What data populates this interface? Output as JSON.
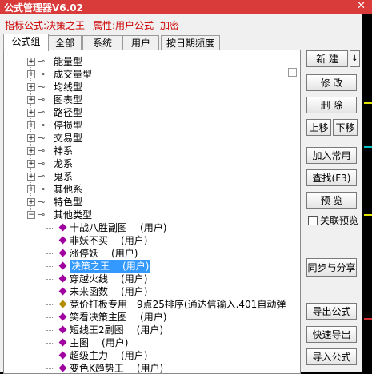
{
  "window": {
    "title": "公式管理器V6.02",
    "close_icon": "✕"
  },
  "info": {
    "formula_label": "指标公式:决策之王",
    "attr_label": "属性:用户公式",
    "enc_label": "加密"
  },
  "tabs": [
    "公式组",
    "全部",
    "系统",
    "用户",
    "按日期频度"
  ],
  "tree": {
    "groups": [
      "能量型",
      "成交量型",
      "均线型",
      "图表型",
      "路径型",
      "停损型",
      "交易型",
      "神系",
      "龙系",
      "鬼系",
      "其他系",
      "特色型",
      "其他类型"
    ],
    "items": [
      {
        "name": "十战八胜副图",
        "tag": "(用户)"
      },
      {
        "name": "非妖不买",
        "tag": "(用户)"
      },
      {
        "name": "涨停妖",
        "tag": "(用户)"
      },
      {
        "name": "决策之王",
        "tag": "(用户)"
      },
      {
        "name": "穿越火线",
        "tag": "(用户)"
      },
      {
        "name": "未来函数",
        "tag": "(用户)"
      },
      {
        "name": "竞价打板专用",
        "tag": "9点25排序(通达信输入.401自动弹"
      },
      {
        "name": "笑看决策主图",
        "tag": "(用户)"
      },
      {
        "name": "短线王2副图",
        "tag": "(用户)"
      },
      {
        "name": "主图",
        "tag": "(用户)"
      },
      {
        "name": "超级主力",
        "tag": "(用户)"
      },
      {
        "name": "变色K趋势王",
        "tag": "(用户)"
      }
    ]
  },
  "buttons": {
    "new": "新 建",
    "new_arrow": "↓",
    "edit": "修 改",
    "delete": "删 除",
    "up": "上移",
    "down": "下移",
    "add_common": "加入常用",
    "find": "查找(F3)",
    "preview": "预 览",
    "assoc_preview": "关联预览",
    "sync": "同步与分享",
    "export": "导出公式",
    "quick_export": "快速导出",
    "import": "导入公式"
  },
  "colors": {
    "title_bg": "#d93a3a",
    "selection": "#3399ff",
    "info_red": "#cc0000",
    "gem_purple": "#a000a0"
  }
}
